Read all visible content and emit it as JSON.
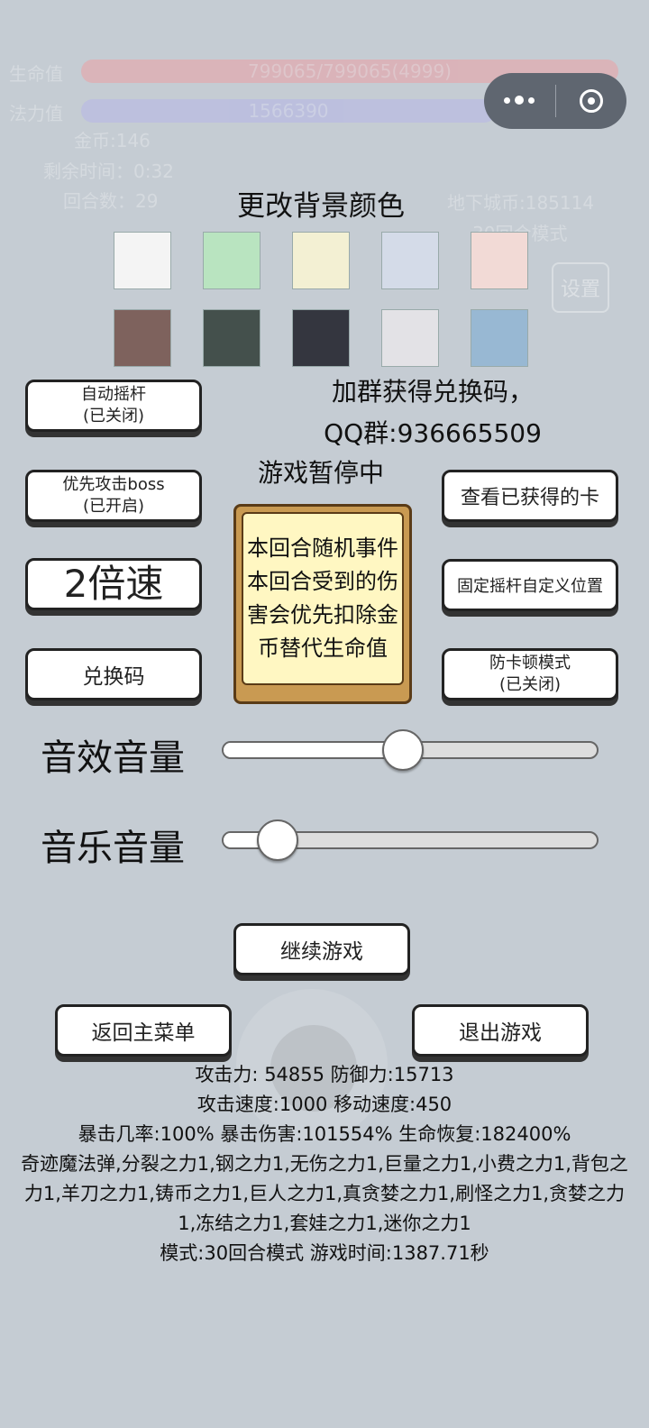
{
  "hud": {
    "hp_label": "生命值",
    "hp_value": "799065/799065(4999)",
    "mp_label": "法力值",
    "mp_value": "1566390",
    "gold": "金币:146",
    "time_left": "剩余时间：0:32",
    "rounds": "回合数：29",
    "dungeon_coins": "地下城币:185114",
    "mode": "30回合模式",
    "settings_label": "设置",
    "colors": {
      "hp": "#e8a3a8",
      "mp": "#b7b8e6"
    }
  },
  "background_color": {
    "title": "更改背景颜色",
    "swatches": [
      "#f4f4f4",
      "#b9e4c0",
      "#f3f0d3",
      "#d4dbe8",
      "#f2dad6",
      "#7e625d",
      "#44504c",
      "#34363f",
      "#e3e2e6",
      "#98b8d3"
    ]
  },
  "left_buttons": {
    "auto_joystick": {
      "line1": "自动摇杆",
      "line2": "(已关闭)"
    },
    "prioritize_boss": {
      "line1": "优先攻击boss",
      "line2": "(已开启)"
    },
    "speed": "2倍速",
    "redeem": "兑换码"
  },
  "group_info": {
    "line1": "加群获得兑换码，",
    "line2": "QQ群:936665509"
  },
  "paused_label": "游戏暂停中",
  "right_buttons": {
    "view_cards": "查看已获得的卡",
    "fixed_joystick": "固定摇杆自定义位置",
    "anti_lag": {
      "line1": "防卡顿模式",
      "line2": "(已关闭)"
    }
  },
  "event_card": {
    "text": "本回合随机事件本回合受到的伤害会优先扣除金币替代生命值"
  },
  "volume": {
    "sfx_label": "音效音量",
    "sfx_value": 0.48,
    "music_label": "音乐音量",
    "music_value": 0.11
  },
  "actions": {
    "continue": "继续游戏",
    "main_menu": "返回主菜单",
    "exit": "退出游戏"
  },
  "stats": {
    "line1": "攻击力:  54855 防御力:15713",
    "line2": "攻击速度:1000 移动速度:450",
    "line3": "暴击几率:100% 暴击伤害:101554% 生命恢复:182400%",
    "line4": "奇迹魔法弹,分裂之力1,钢之力1,无伤之力1,巨量之力1,小费之力1,背包之力1,羊刀之力1,铸币之力1,巨人之力1,真贪婪之力1,刷怪之力1,贪婪之力1,冻结之力1,套娃之力1,迷你之力1",
    "line5": "模式:30回合模式 游戏时间:1387.71秒"
  }
}
